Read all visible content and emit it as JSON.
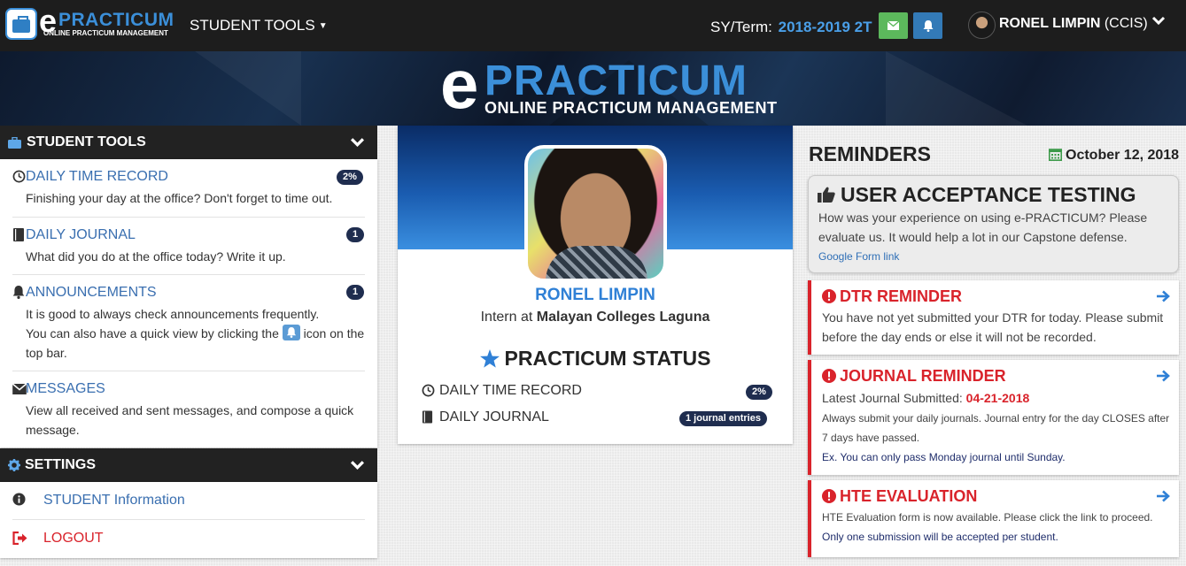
{
  "topbar": {
    "logo_e": "e",
    "logo_word": "PRACTICUM",
    "logo_sub": "ONLINE PRACTICUM MANAGEMENT",
    "menu_label": "STUDENT TOOLS",
    "term_label": "SY/Term:",
    "term_value": "2018-2019 2T",
    "user_name": "RONEL LIMPIN",
    "user_dept": "(CCIS)",
    "mail_color": "#5cb85c",
    "bell_color": "#337ab7"
  },
  "banner": {
    "e": "e",
    "word": "PRACTICUM",
    "sub": "ONLINE PRACTICUM MANAGEMENT"
  },
  "student_tools": {
    "title": "STUDENT TOOLS",
    "items": [
      {
        "label": "DAILY TIME RECORD",
        "icon": "clock-icon",
        "badge": "2%",
        "desc": [
          "Finishing your day at the office? Don't forget to time out."
        ]
      },
      {
        "label": "DAILY JOURNAL",
        "icon": "book-icon",
        "badge": "1",
        "desc": [
          "What did you do at the office today? Write it up."
        ]
      },
      {
        "label": "ANNOUNCEMENTS",
        "icon": "bell-icon",
        "badge": "1",
        "desc": [
          "It is good to always check announcements frequently.",
          "You can also have a quick view by clicking the",
          "icon on the",
          "top bar."
        ]
      },
      {
        "label": "MESSAGES",
        "icon": "envelope-icon",
        "desc": [
          "View all received and sent messages, and compose a quick",
          "message."
        ]
      }
    ]
  },
  "settings": {
    "title": "SETTINGS",
    "items": [
      {
        "label": "STUDENT Information",
        "icon": "info-icon"
      },
      {
        "label": "LOGOUT",
        "icon": "logout-icon",
        "color": "#d9232b"
      }
    ]
  },
  "profile": {
    "name": "RONEL LIMPIN",
    "intern_prefix": "Intern at",
    "company": "Malayan Colleges Laguna",
    "status_title": "PRACTICUM STATUS",
    "rows": [
      {
        "label": "DAILY TIME RECORD",
        "icon": "clock-icon",
        "badge": "2%"
      },
      {
        "label": "DAILY JOURNAL",
        "icon": "book-icon",
        "badge": "1 journal entries"
      }
    ]
  },
  "reminders": {
    "title": "REMINDERS",
    "date": "October 12, 2018",
    "uat": {
      "title": "USER ACCEPTANCE TESTING",
      "text": "How was your experience on using e-PRACTICUM? Please evaluate us. It would help a lot in our Capstone defense.",
      "link": "Google Form link"
    },
    "dtr": {
      "title": "DTR REMINDER",
      "text": "You have not yet submitted your DTR for today. Please submit before the day ends or else it will not be recorded."
    },
    "journal": {
      "title": "JOURNAL REMINDER",
      "latest_label": "Latest Journal Submitted:",
      "latest_date": "04-21-2018",
      "note": "Always submit your daily journals. Journal entry for the day CLOSES after 7 days have passed.",
      "example": "Ex. You can only pass Monday journal until Sunday."
    },
    "hte": {
      "title": "HTE EVALUATION",
      "text": "HTE Evaluation form is now available. Please click the link to proceed.",
      "note": "Only one submission will be accepted per student."
    },
    "accent_color": "#d9232b"
  }
}
